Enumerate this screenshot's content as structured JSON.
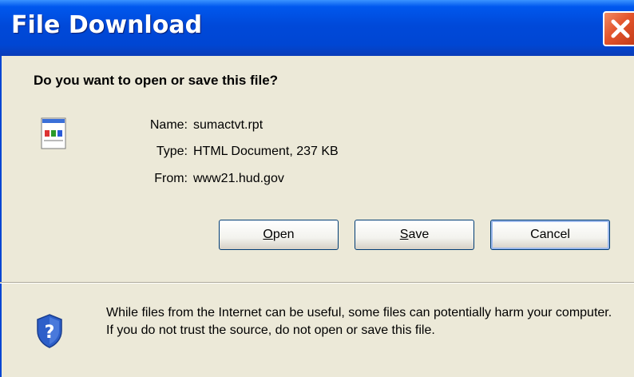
{
  "window": {
    "title": "File Download"
  },
  "dialog": {
    "question": "Do you want to open or save this file?",
    "file": {
      "name_label": "Name:",
      "name_value": "sumactvt.rpt",
      "type_label": "Type:",
      "type_value": "HTML Document, 237 KB",
      "from_label": "From:",
      "from_value": "www21.hud.gov"
    },
    "buttons": {
      "open_mnemonic": "O",
      "open_rest": "pen",
      "save_mnemonic": "S",
      "save_rest": "ave",
      "cancel": "Cancel"
    },
    "warning": "While files from the Internet can be useful, some files can potentially harm your computer. If you do not trust the source, do not open or save this file."
  },
  "colors": {
    "titlebar": "#0046D3",
    "close": "#E3542C",
    "dialog_bg": "#ECE9D8"
  },
  "icons": [
    "close-icon",
    "file-icon",
    "shield-question-icon"
  ]
}
